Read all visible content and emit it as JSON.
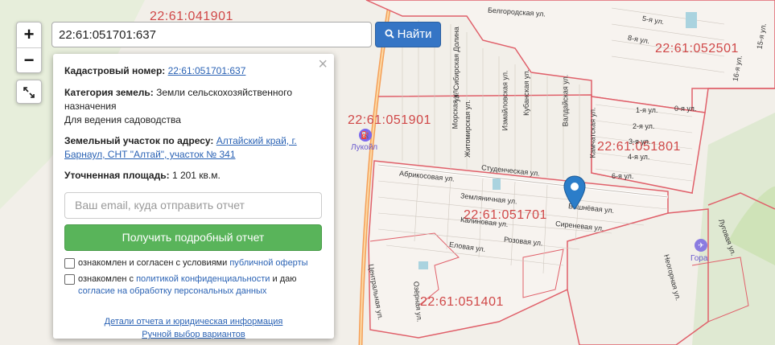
{
  "search": {
    "value": "22:61:051701:637",
    "button_label": "Найти"
  },
  "zoom": {
    "in": "+",
    "out": "−"
  },
  "popup": {
    "close": "×",
    "cadastral_label": "Кадастровый номер:",
    "cadastral_value": "22:61:051701:637",
    "category_label": "Категория земель:",
    "category_value": "Земли сельскохозяйственного назначения",
    "usage": "Для ведения садоводства",
    "address_label": "Земельный участок по адресу:",
    "address_value": "Алтайский край, г. Барнаул, СНТ \"Алтай\", участок № 341",
    "area_label": "Уточненная площадь:",
    "area_value": "1 201 кв.м.",
    "email_placeholder": "Ваш email, куда отправить отчет",
    "get_report": "Получить подробный отчет",
    "agree1_text": "ознакомлен и согласен с условиями",
    "agree1_link": "публичной оферты",
    "agree2_text": "ознакомлен с",
    "agree2_link": "политикой конфиденциальности",
    "agree2_text2": "и даю",
    "agree2_link2": "согласие на обработку персональных данных",
    "link_details": "Детали отчета и юридическая информация",
    "link_manual": "Ручной выбор вариантов"
  },
  "map_labels": {
    "q1": "22:61:041901",
    "q2": "22:61:052501",
    "q3": "22:61:051901",
    "q4": "22:61:051801",
    "q5": "22:61:051701",
    "q6": "22:61:051401"
  },
  "pois": {
    "lukoil": "Лукойл",
    "gora": "Гора"
  },
  "streets": {
    "s1": "Студенческая ул.",
    "s2": "Абрикосовая ул.",
    "s3": "Земляничная ул.",
    "s4": "Калиновая ул.",
    "s5": "Розовая ул.",
    "s6": "Еловая ул.",
    "s7": "Вишнёвая ул.",
    "s8": "Сиреневая ул.",
    "s9": "Морская ул.",
    "s10": "ул. Сибирская Долина",
    "s11": "Житомирская ул.",
    "s12": "Измайловская ул.",
    "s13": "Кубанская ул.",
    "s14": "Валдайская ул.",
    "s15": "Камчатская ул.",
    "s16": "1-я ул.",
    "s17": "2-я ул.",
    "s18": "3-я ул.",
    "s19": "4-я ул.",
    "s20": "6-я ул.",
    "s21": "0-я ул.",
    "s22": "Центральная ул.",
    "s23": "Луговая ул.",
    "s24": "Неогорная ул.",
    "s25": "Белгородская ул.",
    "s26": "5-я ул.",
    "s27": "8-я ул.",
    "s28": "16-я ул.",
    "s29": "15-я ул.",
    "s30": "Озёрная ул."
  },
  "colors": {
    "boundary": "#e0606a",
    "road": "#f5a05a",
    "button": "#3575c5",
    "green_button": "#59b45a",
    "pin": "#2b7dc9"
  }
}
